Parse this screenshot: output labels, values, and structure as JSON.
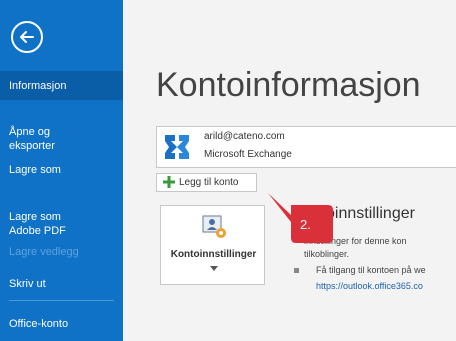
{
  "sidebar": {
    "items": [
      {
        "label": "Informasjon",
        "selected": true
      },
      {
        "label": "Åpne og\neksporter"
      },
      {
        "label": "Lagre som"
      },
      {
        "label": "Lagre som\nAdobe PDF"
      },
      {
        "label": "Lagre vedlegg",
        "disabled": true
      },
      {
        "label": "Skriv ut"
      },
      {
        "label": "Office-konto"
      }
    ]
  },
  "main": {
    "title": "Kontoinformasjon",
    "account": {
      "email": "arild@cateno.com",
      "type": "Microsoft Exchange"
    },
    "add_account_label": "Legg til konto",
    "settings_tile_label": "Kontoinnstillinger",
    "section": {
      "heading": "oinnstillinger",
      "desc_line1": "innstillinger for denne kon",
      "desc_line2": "tilkoblinger.",
      "bullet_text": "Få tilgang til kontoen på we",
      "link": "https://outlook.office365.co"
    }
  },
  "annotation": {
    "label": "2.",
    "color": "#d9303a"
  },
  "colors": {
    "sidebar": "#0f72c6",
    "sidebar_selected": "#0a5ea8"
  }
}
